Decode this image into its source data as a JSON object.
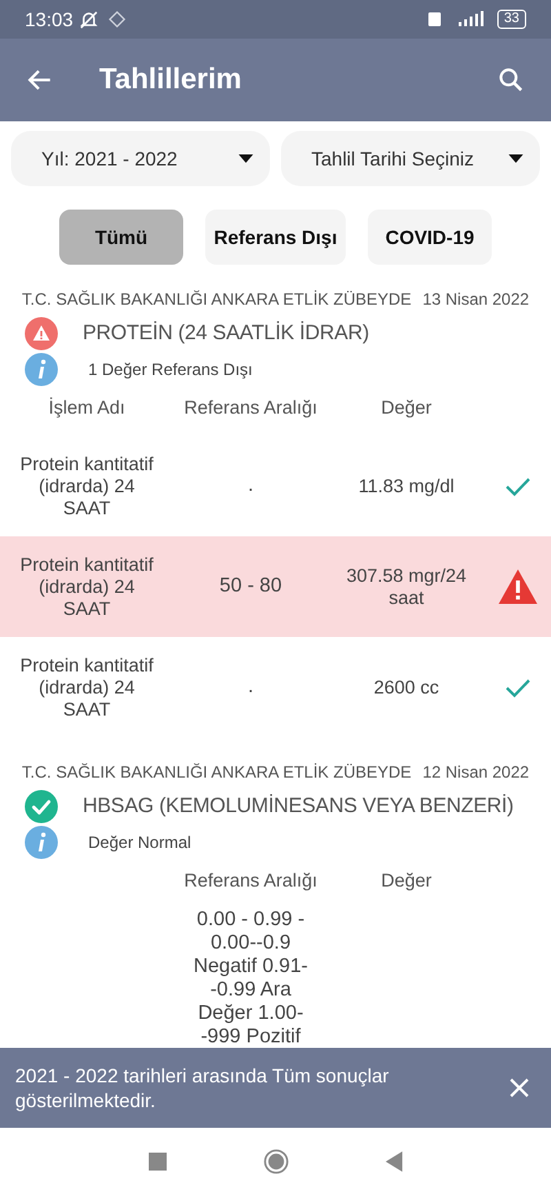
{
  "status_bar": {
    "time": "13:03",
    "battery": "33"
  },
  "app_bar": {
    "title": "Tahlillerim"
  },
  "dropdowns": [
    {
      "label": "Yıl: 2021 - 2022"
    },
    {
      "label": "Tahlil Tarihi Seçiniz"
    }
  ],
  "filters": [
    {
      "label": "Tümü",
      "selected": true
    },
    {
      "label": "Referans Dışı",
      "selected": false
    },
    {
      "label": "COVID-19",
      "selected": false
    }
  ],
  "groups": [
    {
      "institution": "T.C. SAĞLIK BAKANLIĞI ANKARA ETLİK ZÜBEYDE",
      "date": "13 Nisan 2022",
      "abnormal": true,
      "title": "PROTEİN (24 SAATLİK İDRAR)",
      "info": "1 Değer Referans Dışı",
      "columns": {
        "name": "İşlem Adı",
        "reference": "Referans Aralığı",
        "value": "Değer"
      },
      "rows": [
        {
          "name": "Protein kantitatif (idrarda) 24 SAAT",
          "reference": ".",
          "value": "11.83 mg/dl",
          "abnormal": false
        },
        {
          "name": "Protein kantitatif (idrarda) 24 SAAT",
          "reference": "50 - 80",
          "value": "307.58 mgr/24 saat",
          "abnormal": true
        },
        {
          "name": "Protein kantitatif (idrarda) 24 SAAT",
          "reference": ".",
          "value": "2600 cc",
          "abnormal": false
        }
      ]
    },
    {
      "institution": "T.C. SAĞLIK BAKANLIĞI ANKARA ETLİK ZÜBEYDE",
      "date": "12 Nisan 2022",
      "abnormal": false,
      "title": "HBSAG (KEMOLUMİNESANS VEYA BENZERİ)",
      "info": "Değer Normal",
      "columns": {
        "reference": "Referans Aralığı",
        "value": "Değer"
      },
      "rows": [
        {
          "reference": "0.00 - 0.99  - 0.00--0.9 Negatif 0.91--0.99 Ara Değer 1.00--999 Pozitif"
        }
      ]
    }
  ],
  "snackbar": {
    "message": "2021 - 2022 tarihleri arasında Tüm sonuçlar gösterilmektedir."
  }
}
